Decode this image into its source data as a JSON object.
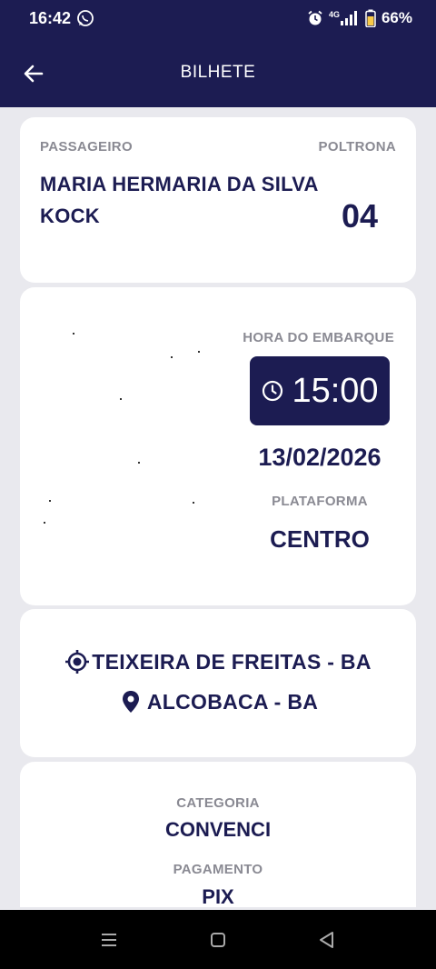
{
  "status_bar": {
    "time": "16:42",
    "battery": "66%",
    "network": "4G"
  },
  "app_bar": {
    "title": "BILHETE"
  },
  "passenger": {
    "label": "PASSAGEIRO",
    "name": "MARIA HERMARIA DA SILVA KOCK",
    "seat_label": "POLTRONA",
    "seat": "04"
  },
  "boarding": {
    "time_label": "HORA DO EMBARQUE",
    "time": "15:00",
    "date": "13/02/2026",
    "platform_label": "PLATAFORMA",
    "platform": "CENTRO"
  },
  "route": {
    "origin": "TEIXEIRA DE FREITAS - BA",
    "destination": "ALCOBACA - BA"
  },
  "details": {
    "category_label": "CATEGORIA",
    "category": "CONVENCI",
    "payment_label": "PAGAMENTO",
    "payment": "PIX"
  },
  "colors": {
    "primary": "#1c1c52",
    "label_gray": "#8a8a93",
    "background": "#e9e9ee"
  },
  "icons": {
    "back": "arrow-left-icon",
    "clock": "clock-icon",
    "origin": "crosshair-icon",
    "destination": "location-pin-icon"
  }
}
